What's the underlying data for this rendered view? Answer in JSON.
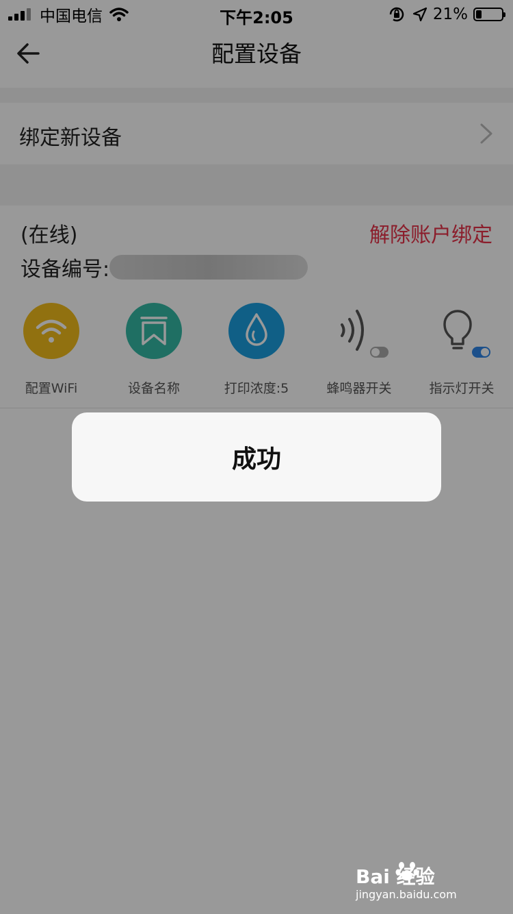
{
  "status_bar": {
    "carrier": "中国电信",
    "time": "下午2:05",
    "battery_percent_text": "21%",
    "battery_level": 0.21
  },
  "nav": {
    "title": "配置设备",
    "back_icon": "arrow-left-icon"
  },
  "bind_row": {
    "label": "绑定新设备",
    "chevron_icon": "chevron-right-icon"
  },
  "device": {
    "status": "(在线)",
    "unbind_label": "解除账户绑定",
    "number_label": "设备编号:",
    "number_value": "",
    "actions": [
      {
        "label": "配置WiFi",
        "icon": "wifi-icon",
        "color": "#f2bc1b"
      },
      {
        "label": "设备名称",
        "icon": "bookmark-icon",
        "color": "#35b9a5"
      },
      {
        "label": "打印浓度:5",
        "icon": "droplet-icon",
        "color": "#1c9fe0"
      },
      {
        "label": "蜂鸣器开关",
        "icon": "sound-wave-icon",
        "toggle_on": false
      },
      {
        "label": "指示灯开关",
        "icon": "light-bulb-icon",
        "toggle_on": true
      }
    ]
  },
  "toast": {
    "message": "成功"
  },
  "watermark": {
    "brand": "Bai  经验",
    "url": "jingyan.baidu.com"
  },
  "colors": {
    "accent_red": "#e8334a",
    "toggle_on": "#2f86e8",
    "toggle_off": "#aaaaaa",
    "overlay": "rgba(0,0,0,0.4)"
  }
}
